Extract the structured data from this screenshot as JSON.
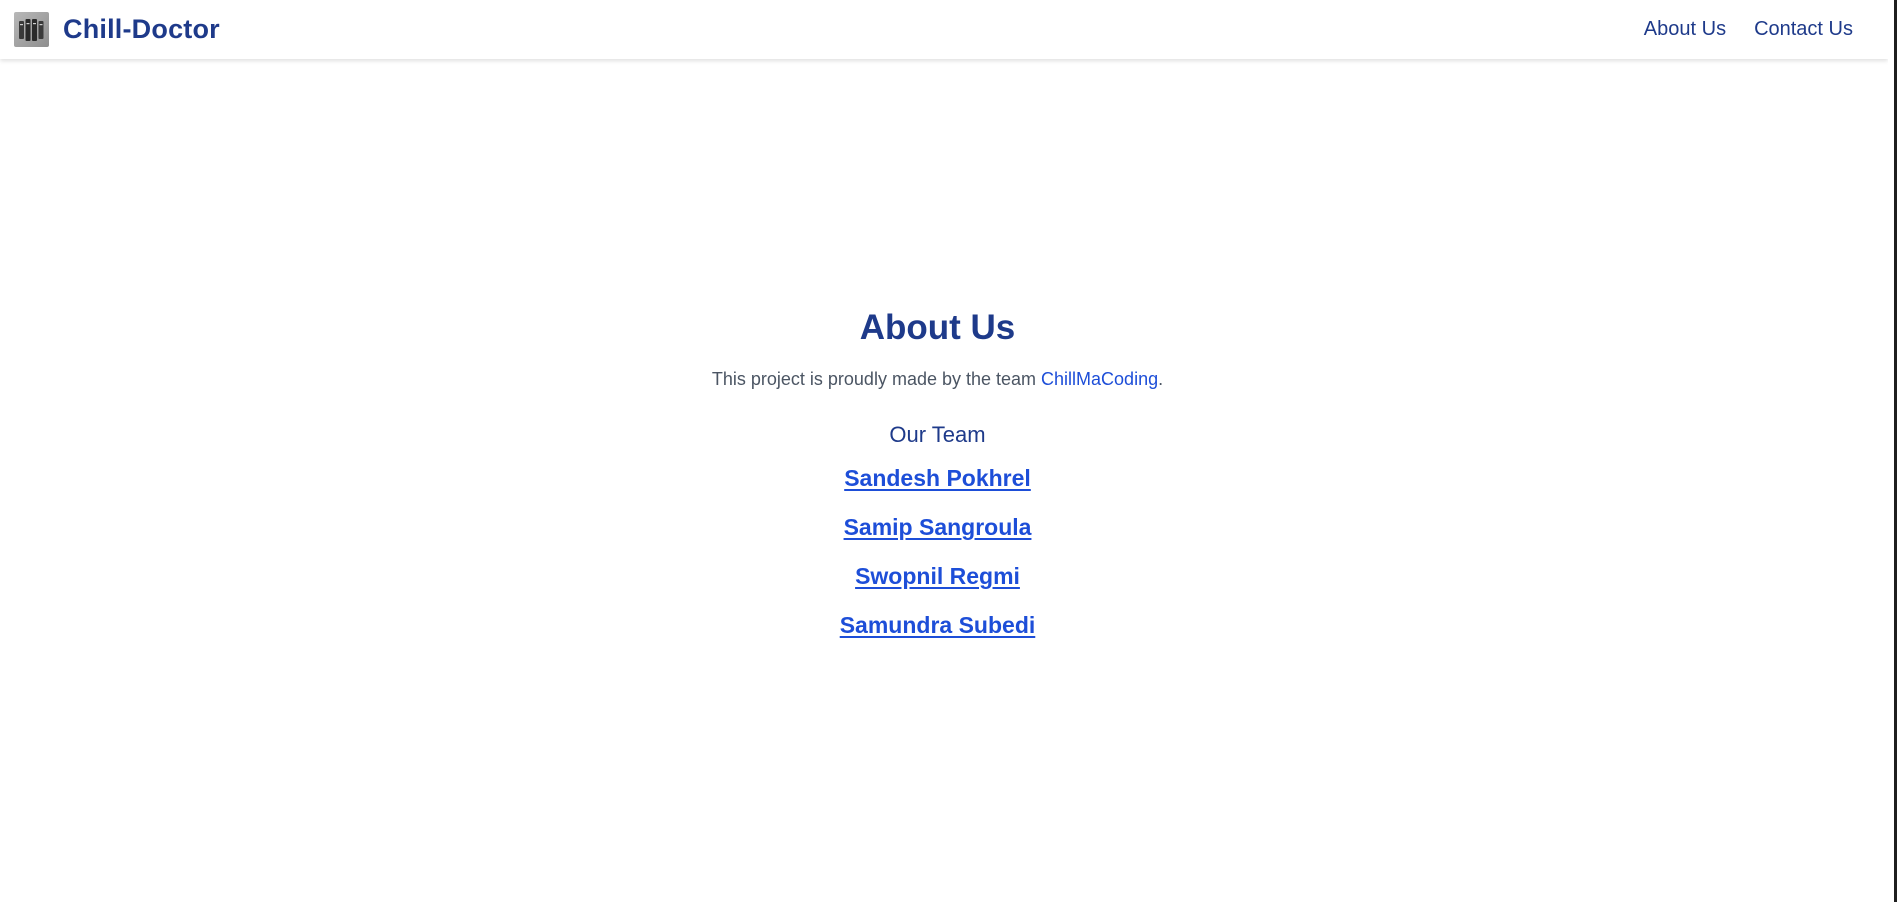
{
  "navbar": {
    "brand_name": "Chill-Doctor",
    "logo_icon": "server-rack-icon",
    "links": {
      "about": "About Us",
      "contact": "Contact Us"
    }
  },
  "main": {
    "title": "About Us",
    "intro_prefix": "This project is proudly made by the team ",
    "team_link": "ChillMaCoding",
    "intro_suffix": ".",
    "team_heading": "Our Team",
    "members": [
      {
        "name": "Sandesh Pokhrel"
      },
      {
        "name": "Samip Sangroula"
      },
      {
        "name": "Swopnil Regmi"
      },
      {
        "name": "Samundra Subedi"
      }
    ]
  },
  "colors": {
    "brand": "#1e3a8a",
    "link": "#1d4ed8",
    "body_text": "#4b5563"
  }
}
